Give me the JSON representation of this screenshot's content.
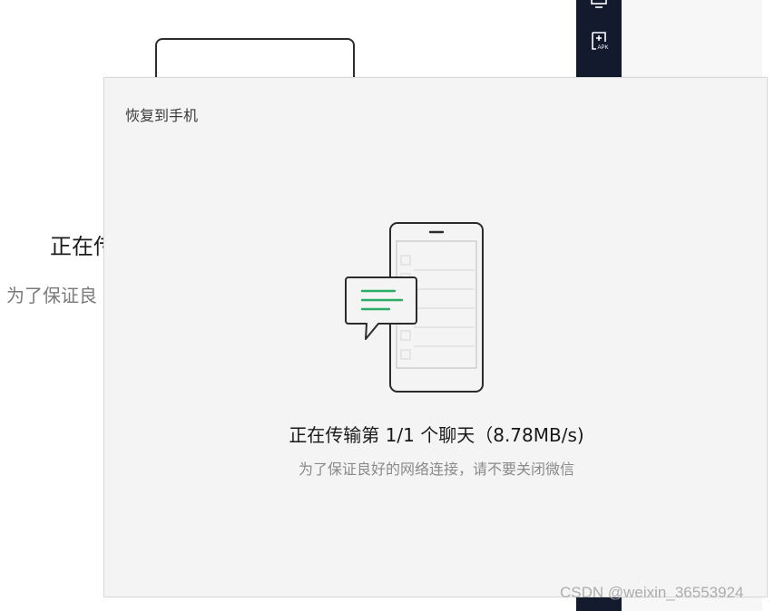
{
  "background": {
    "title_partial": "正在传",
    "subtitle_partial": "为了保证良",
    "sidebar_icons": [
      "monitor-icon",
      "apk-install-icon"
    ],
    "sidebar_icon_label": "APK"
  },
  "dialog": {
    "title": "恢复到手机",
    "status": "正在传输第 1/1 个聊天（8.78MB/s)",
    "hint": "为了保证良好的网络连接，请不要关闭微信",
    "illustration": "phone-chat-transfer-illustration"
  },
  "watermark": "CSDN @weixin_36553924",
  "colors": {
    "dialog_bg": "#f4f4f4",
    "sidebar_bg": "#141a2e",
    "accent_green": "#2aae67",
    "text_primary": "#191919",
    "text_secondary": "#8a8a8a"
  }
}
